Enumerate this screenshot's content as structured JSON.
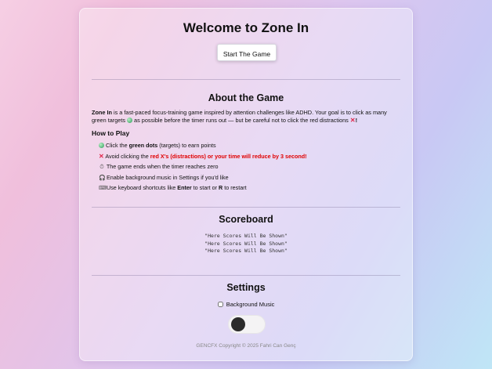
{
  "title": "Welcome to Zone In",
  "start_button": "Start The Game",
  "about": {
    "heading": "About the Game",
    "brand": "Zone In",
    "text_1": " is a fast-paced focus-training game inspired by attention challenges like ADHD. Your goal is to click as many green targets ",
    "text_2": " as possible before the timer runs out — but be careful not to click the red distractions ",
    "text_3": "!"
  },
  "howto": {
    "heading": "How to Play",
    "item1": {
      "pre": "Click the ",
      "bold": "green dots",
      "post": " (targets) to earn points"
    },
    "item2": {
      "pre": "Avoid clicking the ",
      "red": "red X's (distractions) or your time will reduce by 3 second!"
    },
    "item3": "The game ends when the timer reaches zero",
    "item4": "Enable background music in Settings if you'd like",
    "item5": {
      "pre": "Use keyboard shortcuts like ",
      "key1": "Enter",
      "mid": " to start or ",
      "key2": "R",
      "post": " to restart"
    }
  },
  "scoreboard": {
    "heading": "Scoreboard",
    "rows": [
      "\"Here Scores Will Be Shown\"",
      "\"Here Scores Will Be Shown\"",
      "\"Here Scores Will Be Shown\""
    ]
  },
  "settings": {
    "heading": "Settings",
    "music_label": "Background Music",
    "music_checked": false,
    "toggle_on": false
  },
  "footer": "GENCFX Copyright © 2025 Fahri Can Genç",
  "icons": {
    "target": "green-dot-icon",
    "distraction": "red-x-icon",
    "timer": "stopwatch-icon",
    "music": "headphones-icon",
    "keyboard": "keyboard-icon"
  },
  "colors": {
    "green_dot": "#2c9a5a",
    "red_x": "#e0264a",
    "warning_text": "#e00000"
  }
}
